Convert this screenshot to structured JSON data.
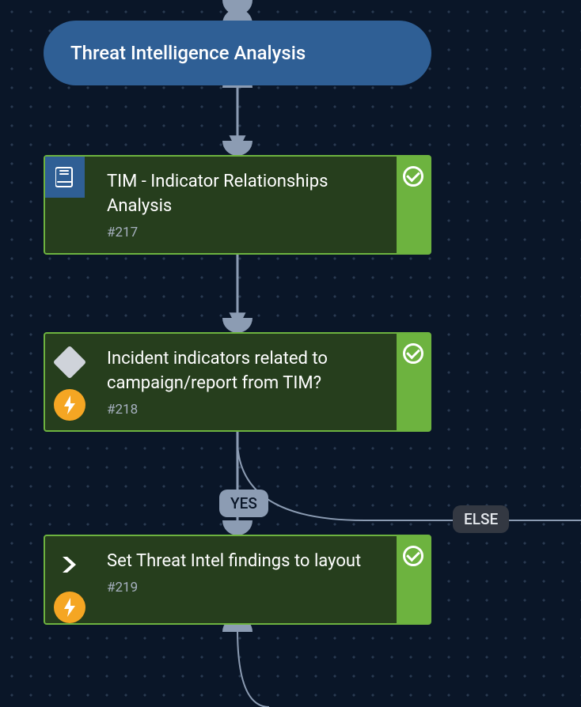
{
  "section": {
    "title": "Threat Intelligence Analysis"
  },
  "nodes": [
    {
      "title": "TIM - Indicator Relationships Analysis",
      "id": "#217",
      "icon": "book",
      "has_bolt": false
    },
    {
      "title": "Incident indicators related to campaign/report from TIM?",
      "id": "#218",
      "icon": "diamond",
      "has_bolt": true
    },
    {
      "title": "Set Threat Intel findings to layout",
      "id": "#219",
      "icon": "chevron",
      "has_bolt": true
    }
  ],
  "branches": {
    "yes": "YES",
    "else": "ELSE"
  }
}
